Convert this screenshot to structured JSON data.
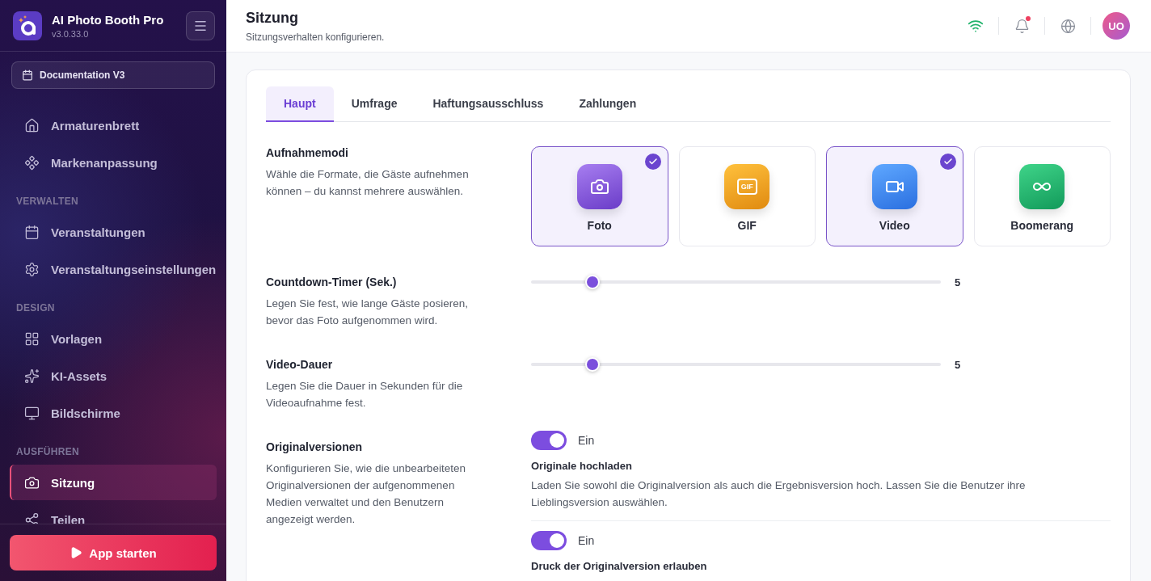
{
  "sidebar": {
    "app": {
      "name": "AI Photo Booth Pro",
      "version": "v3.0.33.0"
    },
    "event_button": {
      "label": "Documentation V3"
    },
    "sections": [
      {
        "items": [
          {
            "label": "Armaturenbrett",
            "selected": false
          },
          {
            "label": "Markenanpassung",
            "selected": false
          }
        ]
      },
      {
        "title": "VERWALTEN",
        "items": [
          {
            "label": "Veranstaltungen",
            "selected": false
          },
          {
            "label": "Veranstaltungseinstellungen",
            "selected": false
          }
        ]
      },
      {
        "title": "DESIGN",
        "items": [
          {
            "label": "Vorlagen",
            "selected": false
          },
          {
            "label": "KI-Assets",
            "selected": false
          },
          {
            "label": "Bildschirme",
            "selected": false
          }
        ]
      },
      {
        "title": "AUSFÜHREN",
        "items": [
          {
            "label": "Sitzung",
            "selected": true
          },
          {
            "label": "Teilen",
            "selected": false
          }
        ]
      }
    ],
    "launch_button": {
      "label": "App starten"
    }
  },
  "header": {
    "title": "Sitzung",
    "subtitle": "Sitzungsverhalten konfigurieren.",
    "notification_dot": true,
    "avatar": "UO"
  },
  "tabs": [
    {
      "label": "Haupt",
      "selected": true
    },
    {
      "label": "Umfrage",
      "selected": false
    },
    {
      "label": "Haftungsausschluss",
      "selected": false
    },
    {
      "label": "Zahlungen",
      "selected": false
    }
  ],
  "settings": [
    {
      "kind": "modes",
      "title": "Aufnahmemodi",
      "description": "Wähle die Formate, die Gäste aufnehmen können – du kannst mehrere auswählen.",
      "modes": [
        {
          "label": "Foto",
          "selected": true
        },
        {
          "label": "GIF",
          "selected": false,
          "icon_text": "GIF"
        },
        {
          "label": "Video",
          "selected": true
        },
        {
          "label": "Boomerang",
          "selected": false
        }
      ]
    },
    {
      "kind": "slider",
      "title": "Countdown-Timer (Sek.)",
      "description": "Legen Sie fest, wie lange Gäste posieren, bevor das Foto aufgenommen wird.",
      "level": 0.15,
      "reading": "5"
    },
    {
      "kind": "slider",
      "title": "Video-Dauer",
      "description": "Legen Sie die Dauer in Sekunden für die Videoaufnahme fest.",
      "level": 0.15,
      "reading": "5"
    },
    {
      "kind": "toggles",
      "title": "Originalversionen",
      "description": "Konfigurieren Sie, wie die unbearbeiteten Originalversionen der aufgenommenen Medien verwaltet und den Benutzern angezeigt werden.",
      "toggles": [
        {
          "on": true,
          "state_label": "Ein",
          "title": "Originale hochladen",
          "description": "Laden Sie sowohl die Originalversion als auch die Ergebnisversion hoch. Lassen Sie die Benutzer ihre Lieblingsversion auswählen."
        },
        {
          "on": true,
          "state_label": "Ein",
          "title": "Druck der Originalversion erlauben"
        }
      ]
    }
  ]
}
